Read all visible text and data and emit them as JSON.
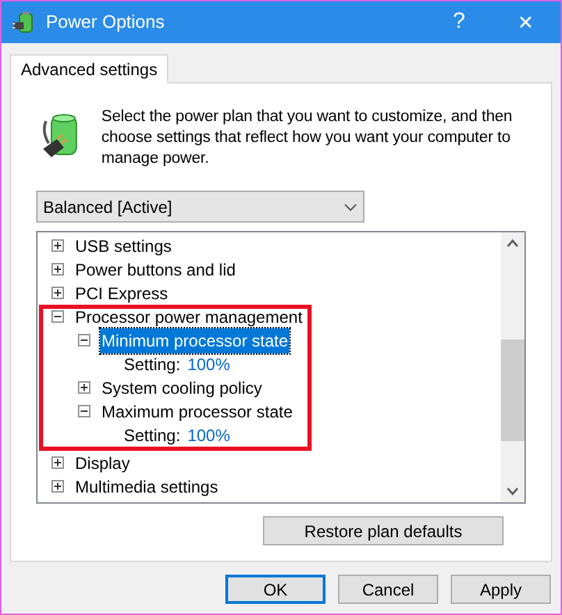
{
  "window": {
    "title": "Power Options",
    "buttons": [
      {
        "kind": "help",
        "label": "?"
      },
      {
        "kind": "close",
        "label": "✕"
      }
    ]
  },
  "tabs": [
    {
      "label": "Advanced settings",
      "selected": true
    }
  ],
  "description": "Select the power plan that you want to customize, and then choose settings that reflect how you want your computer to manage power.",
  "plan_dropdown": {
    "value": "Balanced [Active]"
  },
  "tree": [
    {
      "kind": "node",
      "label": "USB settings",
      "expanded": false,
      "selected": false,
      "highlighted": false
    },
    {
      "kind": "node",
      "label": "Power buttons and lid",
      "expanded": false,
      "selected": false,
      "highlighted": false
    },
    {
      "kind": "node",
      "label": "PCI Express",
      "expanded": false,
      "selected": false,
      "highlighted": false
    },
    {
      "kind": "node",
      "label": "Processor power management",
      "expanded": true,
      "selected": false,
      "highlighted": true,
      "children": [
        {
          "kind": "node",
          "label": "Minimum processor state",
          "expanded": true,
          "selected": true,
          "highlighted": false,
          "children": [
            {
              "kind": "setting",
              "label": "Setting:",
              "value": "100%"
            }
          ]
        },
        {
          "kind": "node",
          "label": "System cooling policy",
          "expanded": false,
          "selected": false,
          "highlighted": false
        },
        {
          "kind": "node",
          "label": "Maximum processor state",
          "expanded": true,
          "selected": false,
          "highlighted": false,
          "children": [
            {
              "kind": "setting",
              "label": "Setting:",
              "value": "100%"
            }
          ]
        }
      ]
    },
    {
      "kind": "node",
      "label": "Display",
      "expanded": false,
      "selected": false,
      "highlighted": false
    },
    {
      "kind": "node",
      "label": "Multimedia settings",
      "expanded": false,
      "selected": false,
      "highlighted": false
    }
  ],
  "restore_button": "Restore plan defaults",
  "buttons": [
    {
      "label": "OK",
      "default": true
    },
    {
      "label": "Cancel",
      "default": false
    },
    {
      "label": "Apply",
      "default": false
    }
  ]
}
